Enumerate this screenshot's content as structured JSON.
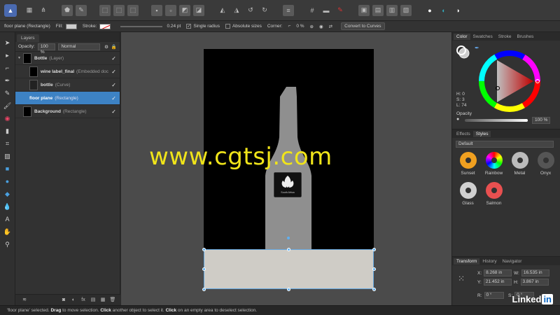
{
  "app": {
    "toolbar_icons": [
      "affinity-logo-icon",
      "pixel-persona-icon",
      "export-persona-icon",
      "assistant-icon",
      "snap-icon",
      "transform-icon",
      "align-icon",
      "arrange-icon",
      "boolean-icon",
      "flip-icon",
      "rotate-icon",
      "layers-order-icon",
      "grid-icon",
      "view-icon",
      "group-icon",
      "color-icon",
      "insert-icon"
    ]
  },
  "context": {
    "selection_label": "floor plane (Rectangle)",
    "fill_label": "Fill:",
    "stroke_label": "Stroke:",
    "stroke_width": "0.24 pt",
    "single_radius_label": "Single radius",
    "absolute_sizes_label": "Absolute sizes",
    "corner_label": "Corner:",
    "corner_value": "0 %",
    "convert_button": "Convert to Curves",
    "colors": {
      "fill": "#cdcdcd",
      "stroke": "#ffffff"
    }
  },
  "tools": [
    "move-tool-icon",
    "node-tool-icon",
    "pen-tool-icon",
    "pencil-tool-icon",
    "brush-tool-icon",
    "fill-tool-icon",
    "transparency-tool-icon",
    "crop-tool-icon",
    "frame-text-icon",
    "rectangle-tool-icon",
    "ellipse-tool-icon",
    "shape-tool-icon",
    "text-tool-icon",
    "hand-tool-icon",
    "zoom-tool-icon"
  ],
  "layers": {
    "tab_label": "Layers",
    "opacity_label": "Opacity:",
    "opacity_value": "100 %",
    "blend_mode": "Normal",
    "rows": [
      {
        "name": "Bottle",
        "type": "(Layer)"
      },
      {
        "name": "wine label_final",
        "type": "(Embedded doc"
      },
      {
        "name": "bottle",
        "type": "(Curve)"
      },
      {
        "name": "floor plane",
        "type": "(Rectangle)"
      },
      {
        "name": "Background",
        "type": "(Rectangle)"
      }
    ]
  },
  "canvas": {
    "watermark": "www.cgtsj.com",
    "label_text": "South Africa",
    "colors": {
      "artboard": "#000000",
      "bottle": "#8f8f8f",
      "floor": "#cfccc6",
      "selection": "#5fb0f0",
      "watermark": "#f0e41a"
    }
  },
  "color_panel": {
    "tabs": [
      "Color",
      "Swatches",
      "Stroke",
      "Brushes"
    ],
    "h": "H: 0",
    "s": "S: 3",
    "l": "L: 74",
    "opacity_label": "Opacity",
    "opacity_value": "100 %"
  },
  "styles_panel": {
    "tabs": [
      "Effects",
      "Styles"
    ],
    "category": "Default",
    "items": [
      {
        "name": "Sunset",
        "color": "#f0a020"
      },
      {
        "name": "Rainbow",
        "color": "#9050e0"
      },
      {
        "name": "Metal",
        "color": "#bbbbbb"
      },
      {
        "name": "Onyx",
        "color": "#555555"
      },
      {
        "name": "Glass",
        "color": "#d0d0d0"
      },
      {
        "name": "Salmon",
        "color": "#e85050"
      }
    ]
  },
  "transform_panel": {
    "tabs": [
      "Transform",
      "History",
      "Navigator"
    ],
    "x_label": "X:",
    "x_value": "8.268 in",
    "y_label": "Y:",
    "y_value": "21.452 in",
    "w_label": "W:",
    "w_value": "16.535 in",
    "h_label": "H:",
    "h_value": "3.867 in",
    "r_label": "R:",
    "r_value": "0 °",
    "s_label": "S:",
    "s_value": "0 °"
  },
  "status": {
    "part1": "'floor plane' selected.",
    "drag": "Drag",
    "part2": "to move selection.",
    "click1": "Click",
    "part3": "another object to select it.",
    "click2": "Click",
    "part4": "on an empty area to deselect selection."
  },
  "brand": {
    "linked": "Linked",
    "in": "in"
  }
}
